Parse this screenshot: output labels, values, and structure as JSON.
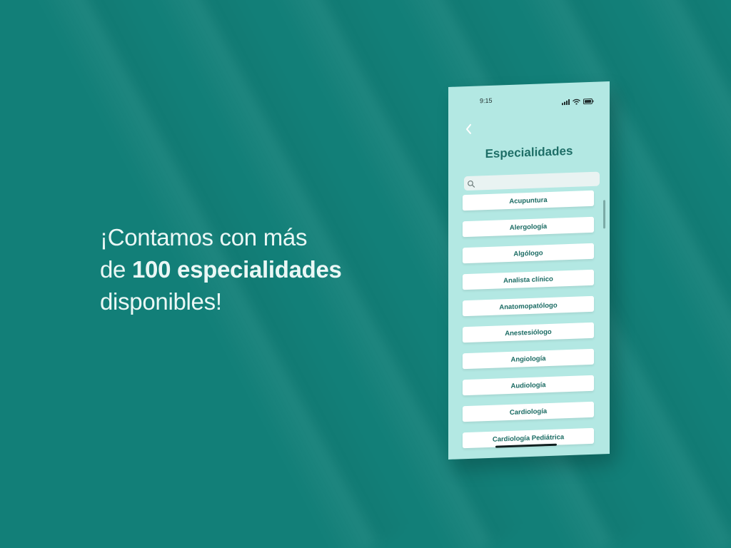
{
  "headline": {
    "line1": "¡Contamos con más",
    "line2_prefix": "de ",
    "line2_bold": "100 especialidades",
    "line3": "disponibles!"
  },
  "phone": {
    "status": {
      "time": "9:15",
      "icons": [
        "signal-icon",
        "wifi-icon",
        "battery-icon"
      ]
    },
    "title": "Especialidades",
    "search_placeholder": "",
    "specialties": [
      "Acupuntura",
      "Alergología",
      "Algólogo",
      "Analista clínico",
      "Anatomopatólogo",
      "Anestesiólogo",
      "Angiología",
      "Audiología",
      "Cardiología",
      "Cardiología Pediátrica"
    ]
  },
  "colors": {
    "background": "#127f78",
    "screen": "#b3e8e3",
    "accent_text": "#1e6e67",
    "item_text": "#196a62"
  }
}
